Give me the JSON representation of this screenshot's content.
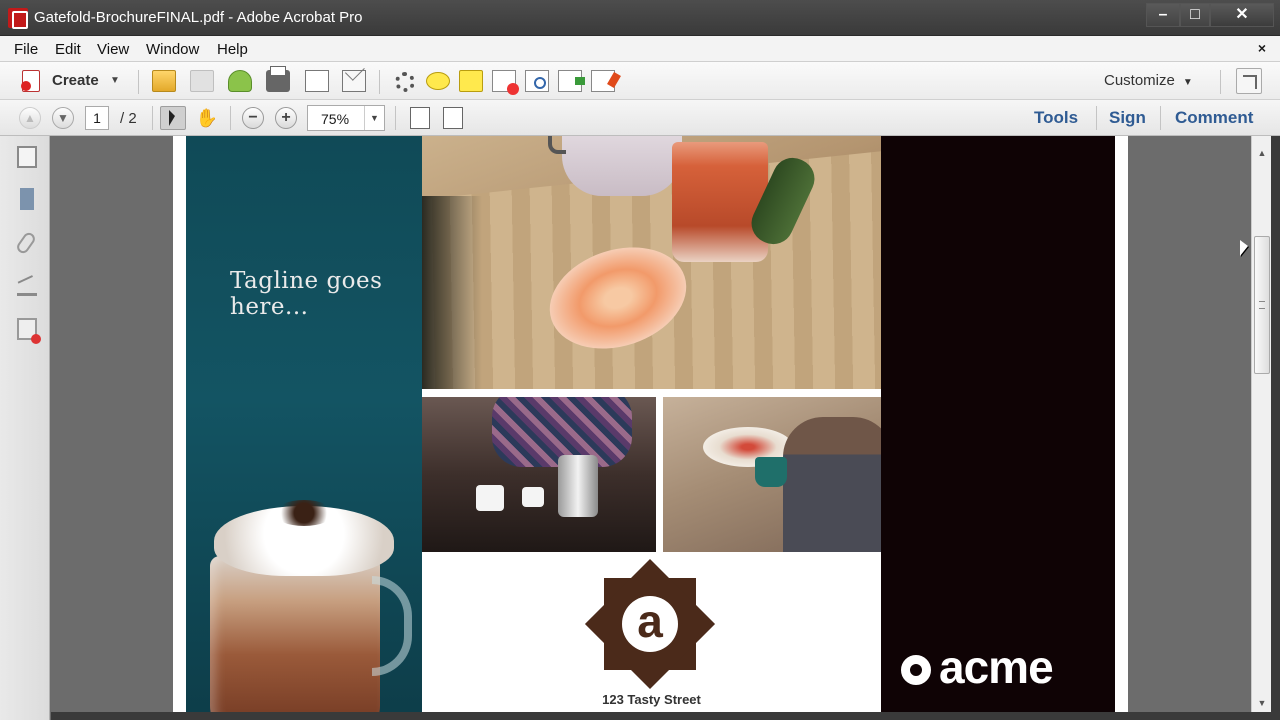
{
  "window": {
    "title": "Gatefold-BrochureFINAL.pdf - Adobe Acrobat Pro",
    "minimize": "–",
    "maximize": "□",
    "close": "✕"
  },
  "menu": {
    "items": [
      "File",
      "Edit",
      "View",
      "Window",
      "Help"
    ],
    "close_doc": "×"
  },
  "toolbar": {
    "create_label": "Create",
    "create_caret": "▼",
    "customize_label": "Customize",
    "customize_caret": "▼"
  },
  "nav": {
    "prev_page": "▲",
    "next_page": "▼",
    "current_page": "1",
    "total_pages": "/  2",
    "hand": "✋",
    "zoom_out": "−",
    "zoom_in": "+",
    "zoom_value": "75%",
    "zoom_dd": "▼"
  },
  "panes": {
    "tools": "Tools",
    "sign": "Sign",
    "comment": "Comment"
  },
  "document": {
    "tagline": "Tagline goes here...",
    "logo_letter": "a",
    "address": "123 Tasty Street",
    "brand": "acme"
  },
  "scrollbar": {
    "up": "▲",
    "down": "▼"
  }
}
